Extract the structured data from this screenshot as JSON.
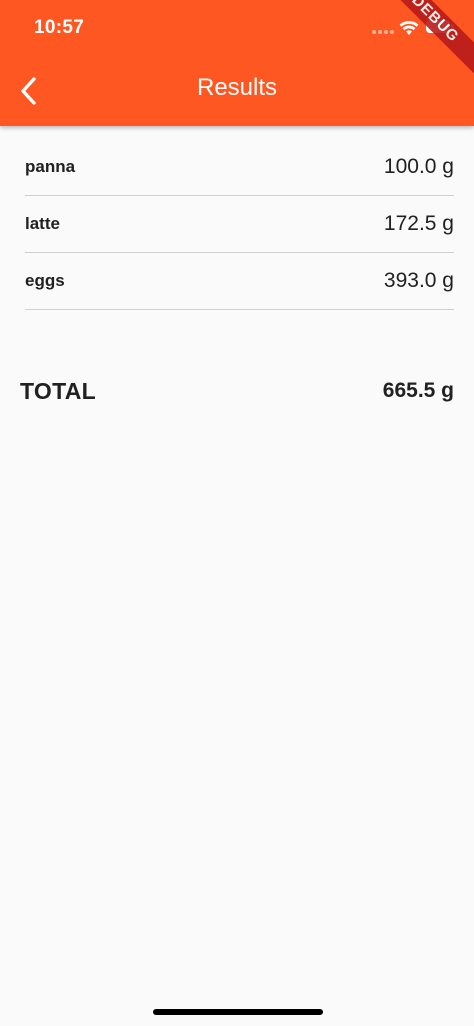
{
  "status_bar": {
    "time": "10:57"
  },
  "debug_banner": "DEBUG",
  "app_bar": {
    "title": "Results",
    "back_icon": "chevron-left-icon",
    "background_color": "#ff5722"
  },
  "items": [
    {
      "name": "panna",
      "weight": "100.0 g"
    },
    {
      "name": "latte",
      "weight": "172.5 g"
    },
    {
      "name": "eggs",
      "weight": "393.0 g"
    }
  ],
  "total": {
    "label": "TOTAL",
    "value": "665.5 g"
  }
}
